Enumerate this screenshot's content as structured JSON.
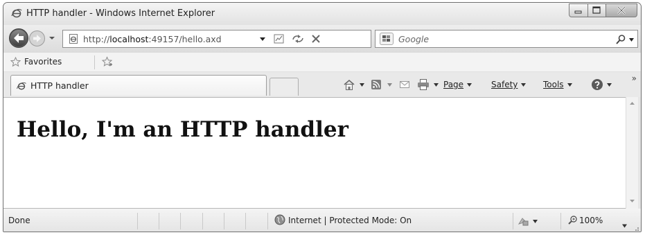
{
  "window": {
    "title": "HTTP handler - Windows Internet Explorer"
  },
  "navigation": {
    "url_prefix": "http://",
    "url_host": "localhost",
    "url_rest": ":49157/hello.axd",
    "search_placeholder": "Google"
  },
  "favorites_bar": {
    "favorites_label": "Favorites"
  },
  "tab": {
    "label": "HTTP handler"
  },
  "command_bar": {
    "page_label": "Page",
    "safety_label": "Safety",
    "tools_label": "Tools"
  },
  "page": {
    "heading": "Hello, I'm an HTTP handler"
  },
  "status_bar": {
    "status": "Done",
    "zone": "Internet | Protected Mode: On",
    "zoom": "100%"
  },
  "icons": {
    "browser": "ie-logo-icon",
    "back": "back-arrow-icon",
    "forward": "forward-arrow-icon",
    "compatibility": "compatibility-view-icon",
    "refresh": "refresh-icon",
    "stop": "stop-icon",
    "search": "search-icon",
    "favorites": "star-icon",
    "add_favorite": "add-favorite-icon",
    "home": "home-icon",
    "feeds": "rss-feed-icon",
    "mail": "mail-icon",
    "print": "printer-icon",
    "help": "help-icon",
    "zone": "globe-icon",
    "zoom": "magnifier-icon"
  },
  "colors": {
    "chrome": "#e6e6e6",
    "page_background": "#ffffff",
    "text": "#222222"
  }
}
